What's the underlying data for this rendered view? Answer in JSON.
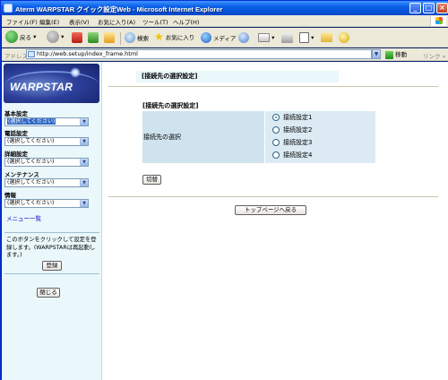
{
  "window": {
    "title": "Aterm WARPSTAR クイック設定Web - Microsoft Internet Explorer",
    "controls": {
      "minimize": "_",
      "maximize": "□",
      "close": "×"
    }
  },
  "menubar": {
    "items": [
      "ファイル(F)",
      "編集(E)",
      "表示(V)",
      "お気に入り(A)",
      "ツール(T)",
      "ヘルプ(H)"
    ]
  },
  "toolbar": {
    "back_label": "戻る",
    "search_label": "検索",
    "favorites_label": "お気に入り",
    "media_label": "メディア",
    "icons": [
      "back-icon",
      "forward-icon",
      "stop-icon",
      "refresh-icon",
      "home-icon",
      "search-icon",
      "favorites-icon",
      "media-icon",
      "history-icon",
      "mail-icon",
      "print-icon",
      "edit-icon",
      "folder-icon",
      "messenger-icon"
    ]
  },
  "addressbar": {
    "label": "アドレス(D)",
    "url": "http://web.setup/index_frame.html",
    "go_label": "移動",
    "links_label": "リンク »"
  },
  "sidebar": {
    "logo_text": "WARPSTAR",
    "sections": [
      {
        "label": "基本設定",
        "select_value": "(選択してください)",
        "highlighted": true
      },
      {
        "label": "電話設定",
        "select_value": "(選択してください)",
        "highlighted": false
      },
      {
        "label": "詳細設定",
        "select_value": "(選択してください)",
        "highlighted": false
      },
      {
        "label": "メンテナンス",
        "select_value": "(選択してください)",
        "highlighted": false
      },
      {
        "label": "情報",
        "select_value": "(選択してください)",
        "highlighted": false
      }
    ],
    "menu_list_link": "メニュー一覧",
    "help_text": "このボタンをクリックして設定を登録します。(WARPSTARは再起動します。)",
    "register_button": "登録",
    "close_button": "閉じる"
  },
  "main": {
    "page_title": "[接続先の選択設定]",
    "section_title": "[接続先の選択設定]",
    "row_label": "接続先の選択",
    "options": [
      {
        "label": "接続設定1",
        "checked": true
      },
      {
        "label": "接続設定2",
        "checked": false
      },
      {
        "label": "接続設定3",
        "checked": false
      },
      {
        "label": "接続設定4",
        "checked": false
      }
    ],
    "switch_button": "切替",
    "top_page_button": "トップページへ戻る"
  },
  "colors": {
    "titlebar": "#0a5fe8",
    "sidebar_bg": "#eaf7fb",
    "table_bg": "#cfe3ee",
    "link": "#0000cc"
  }
}
